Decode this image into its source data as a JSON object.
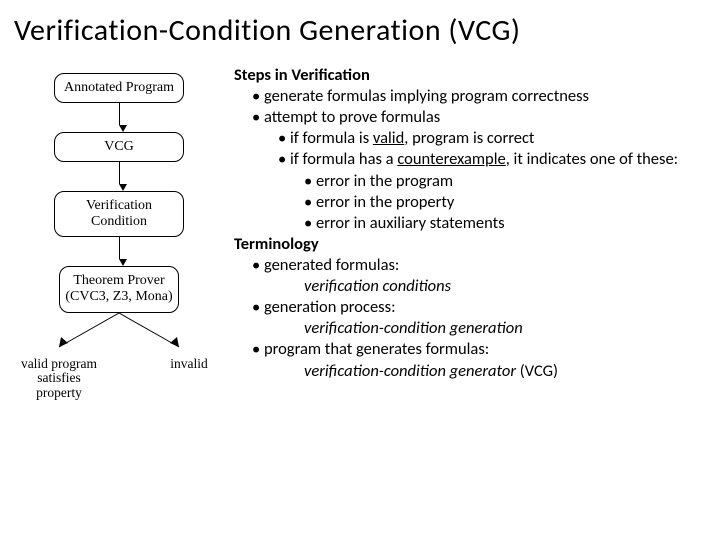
{
  "title": "Verification-Condition Generation (VCG)",
  "diagram": {
    "box_annotated": "Annotated Program",
    "box_vcg": "VCG",
    "box_vc": "Verification Condition",
    "box_prover": "Theorem Prover (CVC3, Z3, Mona)",
    "leaf_valid": "valid program satisfies property",
    "leaf_invalid": "invalid"
  },
  "text": {
    "h1": "Steps in Verification",
    "b1": "generate formulas implying program correctness",
    "b2": "attempt to prove formulas",
    "b2a_pre": "if formula is ",
    "b2a_u": "valid",
    "b2a_post": ", program is correct",
    "b2b_pre": "if formula has a ",
    "b2b_u": "counterexample",
    "b2b_post": ", it indicates one of these:",
    "b2b1": "error in the program",
    "b2b2": "error in the property",
    "b2b3": "error in auxiliary statements",
    "h2": "Terminology",
    "t1": "generated formulas:",
    "t1v": "verification conditions",
    "t2": "generation process:",
    "t2v": "verification-condition generation",
    "t3": "program that generates formulas:",
    "t3v_pre": "verification-condition generator",
    "t3v_post": " (VCG)"
  }
}
